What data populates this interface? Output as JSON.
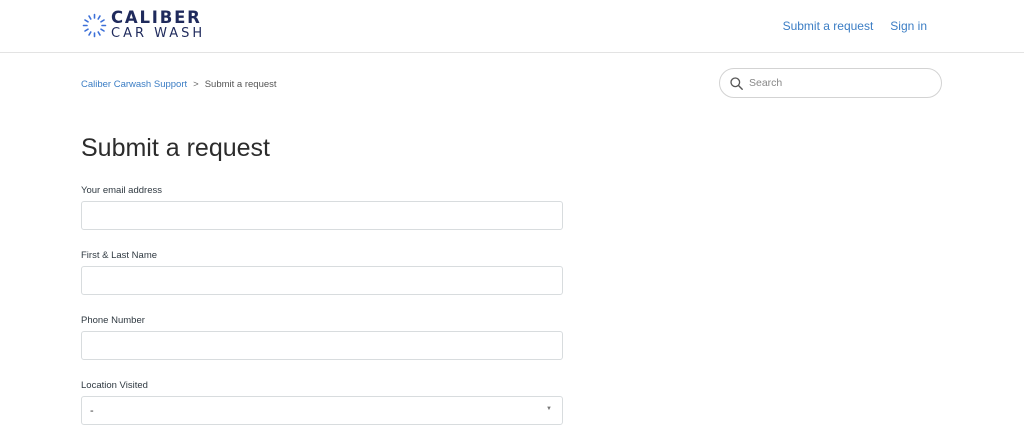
{
  "header": {
    "logo": {
      "line1": "CALIBER",
      "line2": "CAR WASH"
    },
    "nav": {
      "submit_request": "Submit a request",
      "sign_in": "Sign in"
    }
  },
  "breadcrumb": {
    "root": "Caliber Carwash Support",
    "separator": ">",
    "current": "Submit a request"
  },
  "search": {
    "placeholder": "Search"
  },
  "page": {
    "title": "Submit a request"
  },
  "form": {
    "email": {
      "label": "Your email address",
      "value": ""
    },
    "name": {
      "label": "First & Last Name",
      "value": ""
    },
    "phone": {
      "label": "Phone Number",
      "value": ""
    },
    "location": {
      "label": "Location Visited",
      "selected": "-"
    }
  },
  "colors": {
    "link": "#3b7dc4",
    "brand_navy": "#1f2a5c",
    "border": "#d8dcde"
  }
}
